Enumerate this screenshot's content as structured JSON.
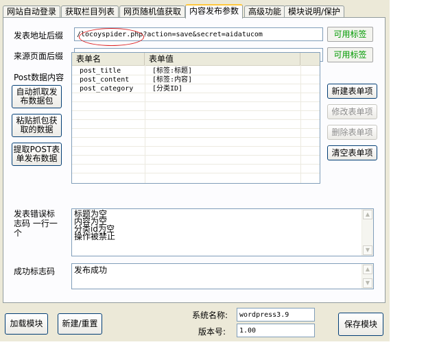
{
  "tabs": [
    {
      "label": "网站自动登录"
    },
    {
      "label": "获取栏目列表"
    },
    {
      "label": "网页随机值获取"
    },
    {
      "label": "内容发布参数"
    },
    {
      "label": "高级功能"
    },
    {
      "label": "模块说明/保护"
    }
  ],
  "active_tab": "内容发布参数",
  "publish_url": {
    "label": "发表地址后缀",
    "value": "/locoyspider.php?action=save&secret=aidatucom",
    "button": "可用标签"
  },
  "source_url": {
    "label": "来源页面后缀",
    "value": "",
    "button": "可用标签"
  },
  "post": {
    "label": "Post数据内容",
    "left_buttons": [
      "自动抓取发布数据包",
      "粘贴抓包获取的数据",
      "提取POST表单发布数据"
    ],
    "columns": [
      "表单名",
      "表单值"
    ],
    "rows": [
      {
        "name": "post_title",
        "value": "[标签:标题]"
      },
      {
        "name": "post_content",
        "value": "[标签:内容]"
      },
      {
        "name": "post_category",
        "value": "[分类ID]"
      }
    ],
    "right_buttons": [
      "新建表单项",
      "修改表单项",
      "删除表单项",
      "清空表单项"
    ]
  },
  "error_codes": {
    "label": "发表错误标志码 一行一个",
    "lines": [
      "标题为空",
      "内容为空",
      "分类id为空",
      "操作被禁止"
    ]
  },
  "success_code": {
    "label": "成功标志码",
    "value": "发布成功"
  },
  "footer": {
    "load_button": "加载模块",
    "new_button": "新建/重置",
    "system_label": "系统名称:",
    "system_value": "wordpress3.9",
    "version_label": "版本号:",
    "version_value": "1.00",
    "save_button": "保存模块"
  }
}
